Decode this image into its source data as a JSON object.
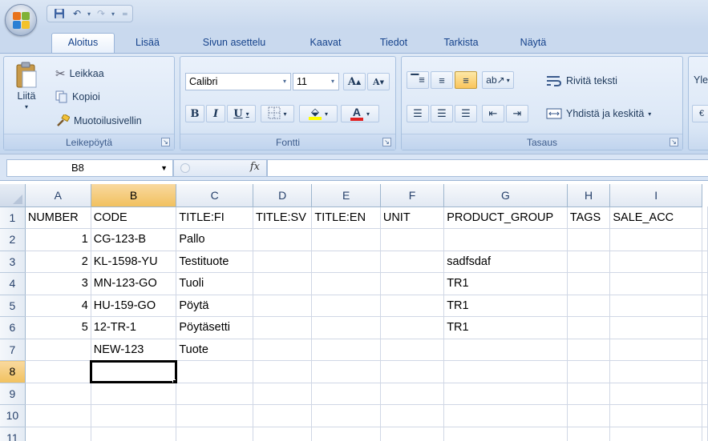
{
  "app": {
    "icons": [
      "office-button",
      "save-icon",
      "undo-icon",
      "redo-icon"
    ]
  },
  "tabs": [
    {
      "label": "Aloitus",
      "active": true
    },
    {
      "label": "Lisää"
    },
    {
      "label": "Sivun asettelu"
    },
    {
      "label": "Kaavat"
    },
    {
      "label": "Tiedot"
    },
    {
      "label": "Tarkista"
    },
    {
      "label": "Näytä"
    }
  ],
  "ribbon": {
    "clipboard": {
      "label": "Leikepöytä",
      "paste": "Liitä",
      "cut": "Leikkaa",
      "copy": "Kopioi",
      "format_painter": "Muotoilusivellin"
    },
    "font": {
      "label": "Fontti",
      "font_name": "Calibri",
      "font_size": "11",
      "bold": "B",
      "italic": "I",
      "underline": "U",
      "grow": "A",
      "shrink": "A"
    },
    "alignment": {
      "label": "Tasaus",
      "wrap_text": "Rivitä teksti",
      "merge_center": "Yhdistä ja keskitä",
      "cut_off": "Yle"
    }
  },
  "formula_bar": {
    "name_box": "B8",
    "fx": "fx",
    "formula": ""
  },
  "sheet": {
    "columns": [
      "A",
      "B",
      "C",
      "D",
      "E",
      "F",
      "G",
      "H",
      "I"
    ],
    "selected_column": "B",
    "selected_row": "8",
    "active_cell": "B8",
    "rows": [
      {
        "num": "1",
        "cells": [
          "NUMBER",
          "CODE",
          "TITLE:FI",
          "TITLE:SV",
          "TITLE:EN",
          "UNIT",
          "PRODUCT_GROUP",
          "TAGS",
          "SALE_ACC"
        ]
      },
      {
        "num": "2",
        "cells": [
          "1",
          "CG-123-B",
          "Pallo",
          "",
          "",
          "",
          "",
          "",
          ""
        ]
      },
      {
        "num": "3",
        "cells": [
          "2",
          "KL-1598-YU",
          "Testituote",
          "",
          "",
          "",
          "sadfsdaf",
          "",
          ""
        ]
      },
      {
        "num": "4",
        "cells": [
          "3",
          "MN-123-GO",
          "Tuoli",
          "",
          "",
          "",
          "TR1",
          "",
          ""
        ]
      },
      {
        "num": "5",
        "cells": [
          "4",
          "HU-159-GO",
          "Pöytä",
          "",
          "",
          "",
          "TR1",
          "",
          ""
        ]
      },
      {
        "num": "6",
        "cells": [
          "5",
          "12-TR-1",
          "Pöytäsetti",
          "",
          "",
          "",
          "TR1",
          "",
          ""
        ]
      },
      {
        "num": "7",
        "cells": [
          "",
          "NEW-123",
          "Tuote",
          "",
          "",
          "",
          "",
          "",
          ""
        ]
      },
      {
        "num": "8",
        "cells": [
          "",
          "",
          "",
          "",
          "",
          "",
          "",
          "",
          ""
        ]
      },
      {
        "num": "9",
        "cells": [
          "",
          "",
          "",
          "",
          "",
          "",
          "",
          "",
          ""
        ]
      },
      {
        "num": "10",
        "cells": [
          "",
          "",
          "",
          "",
          "",
          "",
          "",
          "",
          ""
        ]
      },
      {
        "num": "11",
        "cells": [
          "",
          "",
          "",
          "",
          "",
          "",
          "",
          "",
          ""
        ]
      }
    ]
  },
  "colors": {
    "ribbon_bg": "#d5e3f4",
    "selected_header": "#f1c15f",
    "tab_text": "#15428b",
    "font_color_bar": "#e02020",
    "highlight_bar": "#ffff00"
  }
}
